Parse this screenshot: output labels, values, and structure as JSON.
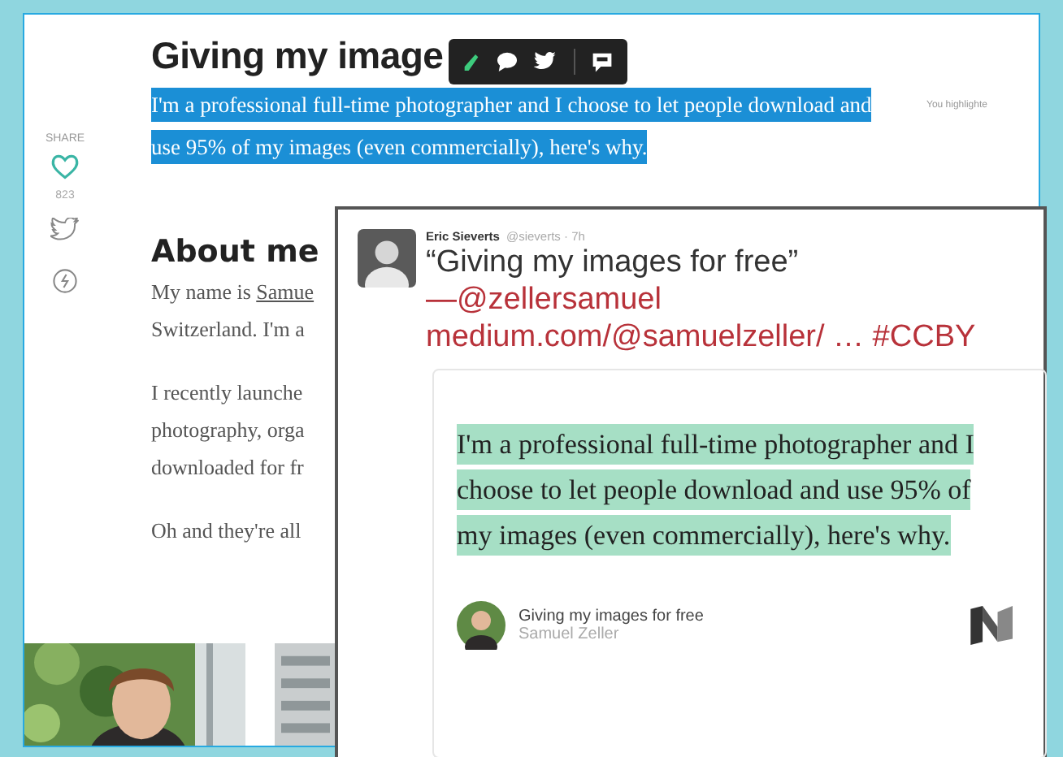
{
  "article": {
    "title": "Giving my image",
    "highlight": "I'm a professional full-time photographer and I choose to let people download and use 95% of my images (even commercially), here's why.",
    "side_note": "You highlighte",
    "heading": "About me",
    "paragraphs": [
      {
        "lead": "My name is ",
        "link": "Samue",
        "lines": [
          "Switzerland. I'm a"
        ]
      },
      {
        "lines": [
          "I recently launche",
          "photography, orga",
          "downloaded for fr"
        ]
      },
      {
        "lines": [
          "Oh and they're all"
        ]
      }
    ]
  },
  "share": {
    "label": "SHARE",
    "count": "823"
  },
  "tweet": {
    "author": "Eric Sieverts",
    "handle": "@sieverts · 7h",
    "text": "“Giving my images for free”",
    "mention": "—@zellersamuel",
    "link": "medium.com/@samuelzeller/  … #CCBY",
    "quote": "I'm a professional full-time photographer and I choose to let people download and use 95% of my images (even commercially), here's why.",
    "card_title": "Giving my images for free",
    "card_author": "Samuel Zeller"
  }
}
